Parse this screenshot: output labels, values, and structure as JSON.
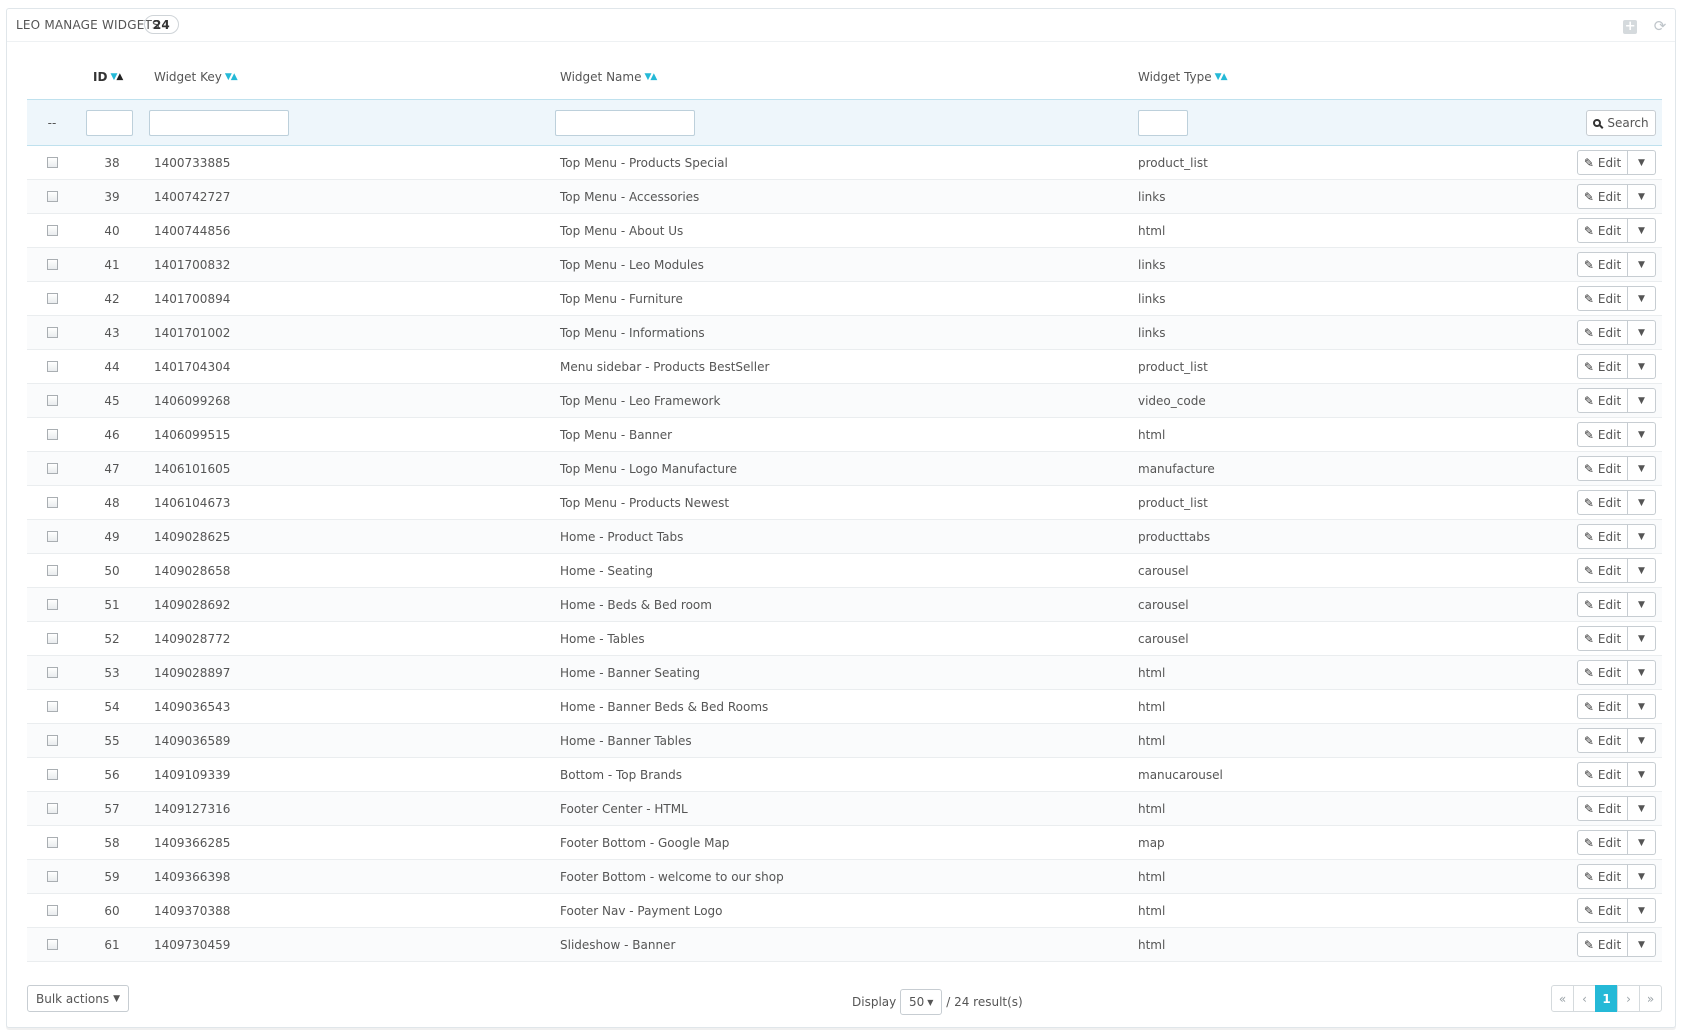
{
  "panel": {
    "title": "LEO MANAGE WIDGETS",
    "count": "24"
  },
  "columns": {
    "id": "ID",
    "key": "Widget Key",
    "name": "Widget Name",
    "type": "Widget Type"
  },
  "filters": {
    "check_placeholder": "--",
    "id_value": "",
    "key_value": "",
    "name_value": "",
    "type_value": "",
    "search_label": "Search"
  },
  "rows": [
    {
      "id": "38",
      "key": "1400733885",
      "name": "Top Menu - Products Special",
      "type": "product_list"
    },
    {
      "id": "39",
      "key": "1400742727",
      "name": "Top Menu - Accessories",
      "type": "links"
    },
    {
      "id": "40",
      "key": "1400744856",
      "name": "Top Menu - About Us",
      "type": "html"
    },
    {
      "id": "41",
      "key": "1401700832",
      "name": "Top Menu - Leo Modules",
      "type": "links"
    },
    {
      "id": "42",
      "key": "1401700894",
      "name": "Top Menu - Furniture",
      "type": "links"
    },
    {
      "id": "43",
      "key": "1401701002",
      "name": "Top Menu - Informations",
      "type": "links"
    },
    {
      "id": "44",
      "key": "1401704304",
      "name": "Menu sidebar - Products BestSeller",
      "type": "product_list"
    },
    {
      "id": "45",
      "key": "1406099268",
      "name": "Top Menu - Leo Framework",
      "type": "video_code"
    },
    {
      "id": "46",
      "key": "1406099515",
      "name": "Top Menu - Banner",
      "type": "html"
    },
    {
      "id": "47",
      "key": "1406101605",
      "name": "Top Menu - Logo Manufacture",
      "type": "manufacture"
    },
    {
      "id": "48",
      "key": "1406104673",
      "name": "Top Menu - Products Newest",
      "type": "product_list"
    },
    {
      "id": "49",
      "key": "1409028625",
      "name": "Home - Product Tabs",
      "type": "producttabs"
    },
    {
      "id": "50",
      "key": "1409028658",
      "name": "Home - Seating",
      "type": "carousel"
    },
    {
      "id": "51",
      "key": "1409028692",
      "name": "Home - Beds & Bed room",
      "type": "carousel"
    },
    {
      "id": "52",
      "key": "1409028772",
      "name": "Home - Tables",
      "type": "carousel"
    },
    {
      "id": "53",
      "key": "1409028897",
      "name": "Home - Banner Seating",
      "type": "html"
    },
    {
      "id": "54",
      "key": "1409036543",
      "name": "Home - Banner Beds & Bed Rooms",
      "type": "html"
    },
    {
      "id": "55",
      "key": "1409036589",
      "name": "Home - Banner Tables",
      "type": "html"
    },
    {
      "id": "56",
      "key": "1409109339",
      "name": "Bottom - Top Brands",
      "type": "manucarousel"
    },
    {
      "id": "57",
      "key": "1409127316",
      "name": "Footer Center - HTML",
      "type": "html"
    },
    {
      "id": "58",
      "key": "1409366285",
      "name": "Footer Bottom - Google Map",
      "type": "map"
    },
    {
      "id": "59",
      "key": "1409366398",
      "name": "Footer Bottom - welcome to our shop",
      "type": "html"
    },
    {
      "id": "60",
      "key": "1409370388",
      "name": "Footer Nav - Payment Logo",
      "type": "html"
    },
    {
      "id": "61",
      "key": "1409730459",
      "name": "Slideshow - Banner",
      "type": "html"
    }
  ],
  "row_action": {
    "edit_label": "Edit"
  },
  "footer": {
    "bulk_label": "Bulk actions",
    "display_label": "Display",
    "per_page": "50",
    "results": "/ 24 result(s)",
    "pages": {
      "first": "«",
      "prev": "‹",
      "current": "1",
      "next": "›",
      "last": "»"
    }
  },
  "colors": {
    "accent": "#25b9d7",
    "filter_bg": "#eef6fb"
  }
}
